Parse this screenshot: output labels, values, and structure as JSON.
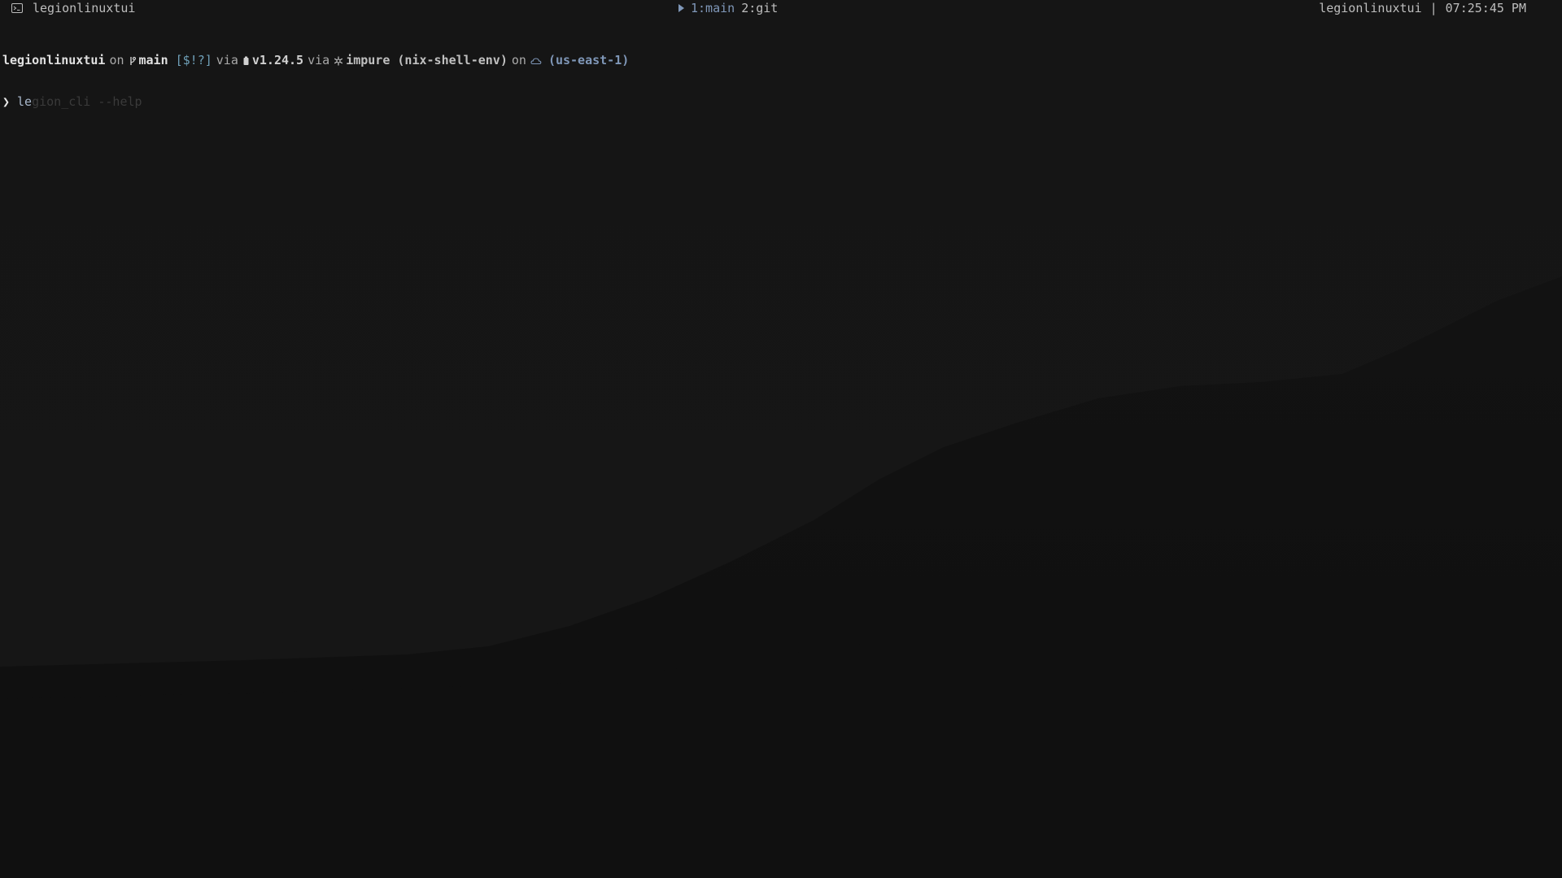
{
  "topbar": {
    "title": "legionlinuxtui",
    "workspaces": [
      {
        "label": "1:main",
        "active": true
      },
      {
        "label": "2:git",
        "active": false
      }
    ],
    "hostname": "legionlinuxtui",
    "separator": "|",
    "time": "07:25:45 PM",
    "icons": [
      "terminal-icon",
      "play-icon"
    ]
  },
  "prompt": {
    "directory": "legionlinuxtui",
    "on1": "on",
    "branch_icon": "git-branch-icon",
    "branch": "main",
    "git_status": "[$!?]",
    "via1": "via",
    "node_icon": "nodejs-icon",
    "node_version": "v1.24.5",
    "via2": "via",
    "nix_icon": "snowflake-icon",
    "nix_shell": "impure (nix-shell-env)",
    "on2": "on",
    "cloud_icon": "cloud-icon",
    "aws_region": "(us-east-1)",
    "prompt_symbol": "❯",
    "typed_text": "le",
    "autosuggestion": "gion_cli --help"
  },
  "colors": {
    "background": "#141414",
    "accent": "#7f97b8",
    "git_status": "#6fa0b8",
    "suggestion": "#3a3a3a"
  }
}
